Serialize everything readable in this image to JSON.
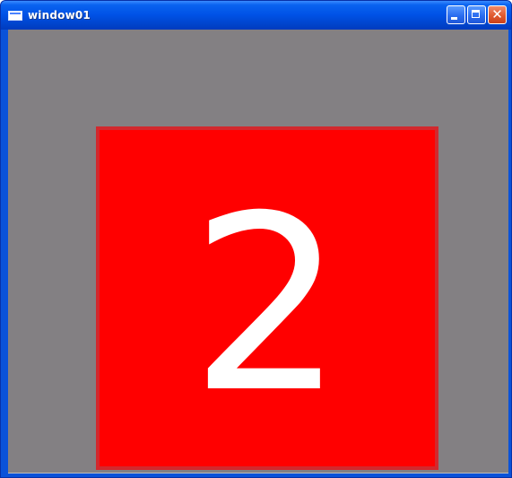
{
  "window": {
    "title": "window01",
    "icon": "window-app-icon",
    "controls": {
      "minimize": "minimize-icon",
      "maximize": "maximize-icon",
      "close": "close-icon",
      "close_glyph": "✕"
    }
  },
  "content": {
    "background_color": "#838083",
    "card_color": "#ff0000",
    "card_border_color": "#d2292e",
    "digit": "2",
    "digit_color": "#ffffff"
  }
}
